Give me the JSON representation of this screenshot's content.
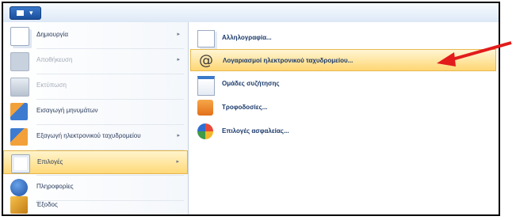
{
  "app": {
    "menu_button_icon": "app-menu-icon"
  },
  "menu": {
    "items": [
      {
        "label": "Δημιουργία",
        "icon": "new-document-icon",
        "has_submenu": true,
        "disabled": false
      },
      {
        "label": "Αποθήκευση",
        "icon": "save-icon",
        "has_submenu": true,
        "disabled": true
      },
      {
        "label": "Εκτύπωση",
        "icon": "print-icon",
        "has_submenu": false,
        "disabled": true
      },
      {
        "label": "Εισαγωγή μηνυμάτων",
        "icon": "import-icon",
        "has_submenu": false,
        "disabled": false
      },
      {
        "label": "Εξαγωγή ηλεκτρονικού ταχυδρομείου",
        "icon": "export-icon",
        "has_submenu": true,
        "disabled": false
      },
      {
        "label": "Επιλογές",
        "icon": "options-icon",
        "has_submenu": true,
        "disabled": false,
        "selected": true
      },
      {
        "label": "Πληροφορίες",
        "icon": "info-icon",
        "has_submenu": false,
        "disabled": false
      },
      {
        "label": "Έξοδος",
        "icon": "exit-icon",
        "has_submenu": false,
        "disabled": false
      }
    ]
  },
  "submenu": {
    "items": [
      {
        "label": "Αλληλογραφία...",
        "icon": "mail-options-icon"
      },
      {
        "label": "Λογαριασμοί ηλεκτρονικού ταχυδρομείου...",
        "icon": "at-sign-icon",
        "highlighted": true
      },
      {
        "label": "Ομάδες συζήτησης",
        "icon": "newsgroup-icon"
      },
      {
        "label": "Τροφοδοσίες...",
        "icon": "rss-icon"
      },
      {
        "label": "Επιλογές ασφαλείας...",
        "icon": "security-icon"
      }
    ]
  },
  "colors": {
    "highlight": "#ffd673",
    "arrow": "#e21b1b"
  }
}
